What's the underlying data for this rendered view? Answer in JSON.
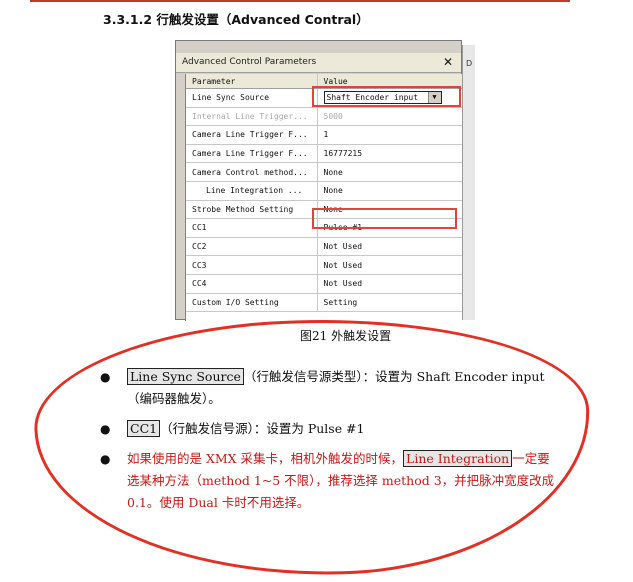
{
  "heading": "3.3.1.2 行触发设置（Advanced Contral）",
  "panel": {
    "title": "Advanced Control Parameters",
    "close_glyph": "✕",
    "side_label": "D",
    "headers": [
      "Parameter",
      "Value"
    ],
    "rows": [
      {
        "param": "Line Sync Source",
        "value": "Shaft Encoder input",
        "dropdown": true
      },
      {
        "param": "Internal Line Trigger...",
        "value": "5000",
        "disabled": true
      },
      {
        "param": "Camera Line Trigger F...",
        "value": "1"
      },
      {
        "param": "Camera Line Trigger F...",
        "value": "16777215"
      },
      {
        "param": "Camera Control method...",
        "value": "None"
      },
      {
        "param": "Line Integration ...",
        "value": "None",
        "indent": true
      },
      {
        "param": "Strobe Method Setting",
        "value": "None"
      },
      {
        "param": "CC1",
        "value": "Pulse #1"
      },
      {
        "param": "CC2",
        "value": "Not Used"
      },
      {
        "param": "CC3",
        "value": "Not Used"
      },
      {
        "param": "CC4",
        "value": "Not Used"
      },
      {
        "param": "Custom I/O Setting",
        "value": "Setting"
      }
    ]
  },
  "caption": "图21    外触发设置",
  "bullets": [
    {
      "term": "Line Sync Source",
      "text": "（行触发信号源类型）：设置为 Shaft Encoder input（编码器触发）。"
    },
    {
      "term": "CC1",
      "text": "（行触发信号源）：设置为 Pulse #1"
    },
    {
      "lead": "如果使用的是 XMX 采集卡，相机外触发的时候，",
      "term": "Line  Integration",
      "tail": "一定要选某种方法（method 1~5 不限），推荐选择 method 3，并把脉冲宽度改成 0.1。使用 Dual 卡时不用选择。"
    }
  ],
  "colors": {
    "annotation_red": "#e23124",
    "text_red": "#c41a14"
  }
}
